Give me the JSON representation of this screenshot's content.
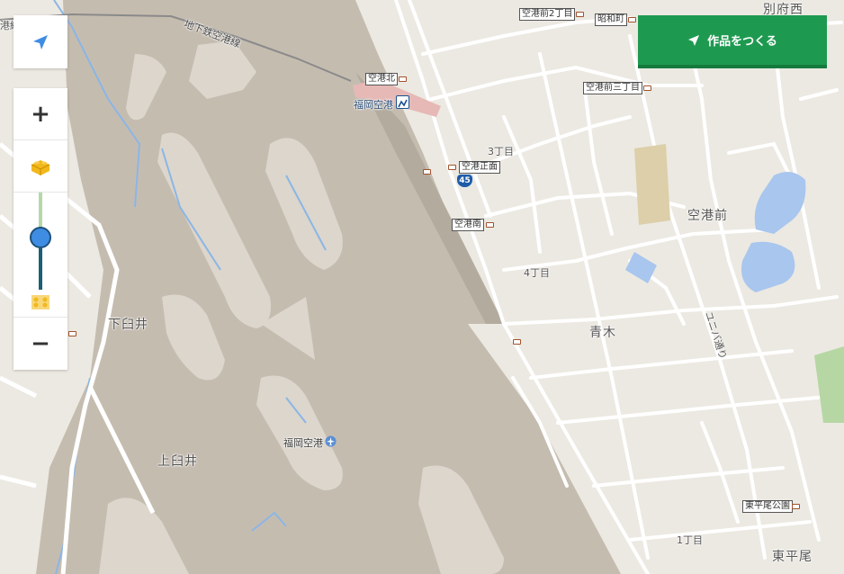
{
  "cta": {
    "label": "作品をつくる",
    "icon": "navigate-arrow-icon",
    "color": "#1e9a50"
  },
  "controls": {
    "locate_icon": "navigate-arrow-icon",
    "zoom_in": "+",
    "zoom_out": "−",
    "block_icon_1": "brick-block-icon",
    "block_icon_2": "flat-brick-icon",
    "zoom_level_fraction": 0.5
  },
  "map": {
    "rail_line": "地下鉄空港線",
    "station_name": "福岡空港",
    "route_number": "45",
    "places": [
      {
        "id": "shimousui",
        "text": "下臼井"
      },
      {
        "id": "kamiusui",
        "text": "上臼井"
      },
      {
        "id": "aoki",
        "text": "青木"
      },
      {
        "id": "kukomae",
        "text": "空港前"
      },
      {
        "id": "higashihirao",
        "text": "東平尾"
      },
      {
        "id": "beppunishi",
        "text": "別府西"
      },
      {
        "id": "chome3",
        "text": "3丁目"
      },
      {
        "id": "chome4",
        "text": "4丁目"
      },
      {
        "id": "chome1",
        "text": "1丁目"
      },
      {
        "id": "unibadori",
        "text": "ユニバ通り"
      },
      {
        "id": "airport_label",
        "text": "福岡空港"
      },
      {
        "id": "ruku",
        "text": "港線"
      }
    ],
    "bus_stops": [
      {
        "id": "kukomae2",
        "text": "空港前2丁目"
      },
      {
        "id": "showamachi",
        "text": "昭和町"
      },
      {
        "id": "kukomae3",
        "text": "空港前三丁目"
      },
      {
        "id": "kukokita",
        "text": "空港北"
      },
      {
        "id": "kukoshomen",
        "text": "空港正面"
      },
      {
        "id": "kukominami",
        "text": "空港南"
      },
      {
        "id": "higashihiraokoen",
        "text": "東平尾公園"
      }
    ]
  }
}
